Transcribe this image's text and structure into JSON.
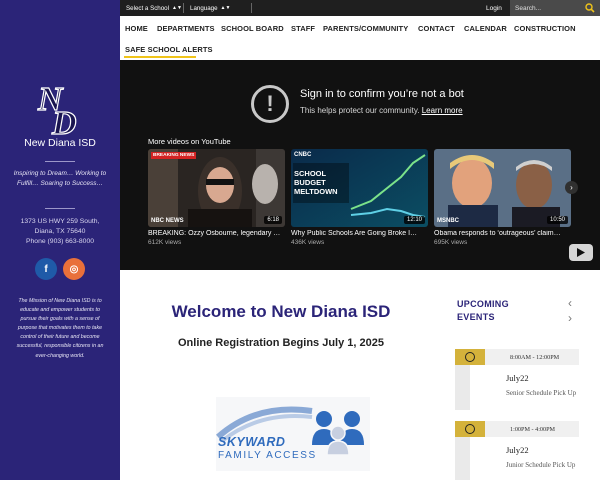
{
  "topbar": {
    "school_select": "Select a School",
    "language_select": "Language",
    "login": "Login",
    "search_placeholder": "Search..."
  },
  "nav": {
    "items": [
      "HOME",
      "DEPARTMENTS",
      "SCHOOL BOARD",
      "STAFF",
      "PARENTS/COMMUNITY",
      "CONTACT",
      "CALENDAR",
      "CONSTRUCTION",
      "SAFE SCHOOL ALERTS"
    ]
  },
  "sidebar": {
    "logo_text": "ND",
    "school_name": "New Diana ISD",
    "tagline": "Inspiring to Dream… Working to Fulfill… Soaring to Success…",
    "address_line1": "1373 US HWY 259 South,",
    "address_line2": "Diana, TX 75640",
    "phone": "Phone (903) 663-8000",
    "social": {
      "facebook": "f",
      "instagram": "◎"
    },
    "mission": "The Mission of New Diana ISD is to educate and empower students to pursue their goals with a sense of purpose that motivates them to take control of their future and become successful, responsible citizens in an ever-changing world."
  },
  "video": {
    "title": "Sign in to confirm you’re not a bot",
    "subtitle": "This helps protect our community.",
    "learn_more": "Learn more",
    "more_videos": "More videos on YouTube",
    "cards": [
      {
        "title": "BREAKING: Ozzy Osbourne, legendary …",
        "views": "612K views",
        "duration": "6:18",
        "badge": "BREAKING NEWS",
        "network": "NBC NEWS"
      },
      {
        "title": "Why Public Schools Are Going Broke I…",
        "views": "436K views",
        "duration": "12:10",
        "overlay": "SCHOOL BUDGET MELTDOWN",
        "network": "CNBC"
      },
      {
        "title": "Obama responds to ‘outrageous’ claim…",
        "views": "695K views",
        "duration": "10:50",
        "network": "MSNBC"
      }
    ]
  },
  "main": {
    "welcome": "Welcome to New Diana ISD",
    "registration": "Online Registration Begins July 1, 2025",
    "skyward_line1": "SKYWARD",
    "skyward_line2": "FAMILY ACCESS"
  },
  "events": {
    "title_line1": "UPCOMING",
    "title_line2": "EVENTS",
    "items": [
      {
        "time": "8:00AM - 12:00PM",
        "date": "July22",
        "name": "Senior Schedule Pick Up"
      },
      {
        "time": "1:00PM - 4:00PM",
        "date": "July22",
        "name": "Junior Schedule Pick Up"
      }
    ]
  },
  "colors": {
    "brand": "#2b2478",
    "accent": "#f0c419",
    "event_clock": "#d4b23b"
  }
}
